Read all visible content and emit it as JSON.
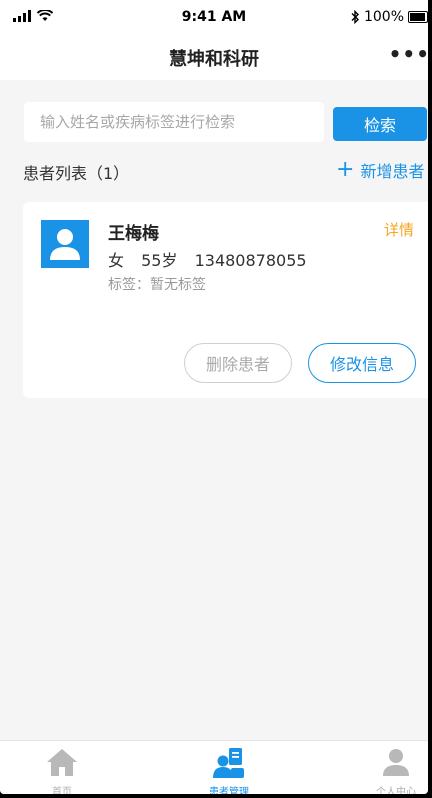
{
  "status_bar": {
    "time": "9:41 AM",
    "battery": "100%"
  },
  "nav": {
    "title": "慧坤和科研",
    "more": "•••"
  },
  "search": {
    "placeholder": "输入姓名或疾病标签进行检索",
    "button": "检索"
  },
  "list": {
    "title": "患者列表（1）",
    "add_label": "新增患者"
  },
  "patient": {
    "name": "王梅梅",
    "detail_link": "详情",
    "gender": "女",
    "age": "55岁",
    "phone": "13480878055",
    "tags": "标签：暂无标签",
    "delete_label": "删除患者",
    "edit_label": "修改信息"
  },
  "tabs": [
    {
      "label": "首页",
      "icon": "home-icon"
    },
    {
      "label": "患者管理",
      "icon": "patient-management-icon",
      "active": true
    },
    {
      "label": "个人中心",
      "icon": "person-icon"
    }
  ],
  "colors": {
    "accent": "#1a93e6",
    "detail": "#f5a623"
  }
}
